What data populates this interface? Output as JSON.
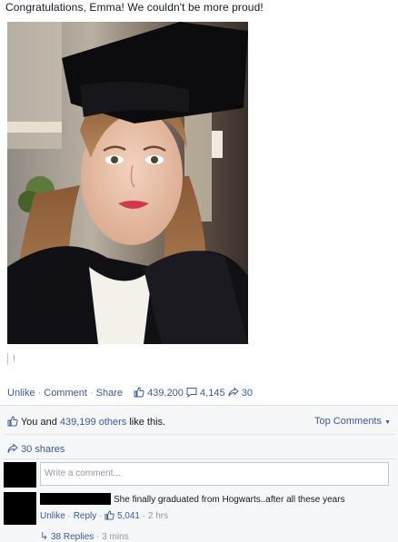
{
  "post": {
    "caption": "Congratulations, Emma! We couldn't be more proud!",
    "attachment_mark": "!"
  },
  "actions": {
    "unlike": "Unlike",
    "comment": "Comment",
    "share": "Share",
    "like_count": "439,200",
    "comment_count": "4,145",
    "share_count": "30",
    "sep": "·"
  },
  "summary": {
    "likes_prefix": "You and ",
    "likes_others": "439,199 others",
    "likes_suffix": " like this.",
    "top_comments": "Top Comments",
    "shares": "30 shares"
  },
  "comment_box": {
    "placeholder": "Write a comment..."
  },
  "comment": {
    "text": "She finally graduated from Hogwarts..after all these years",
    "unlike": "Unlike",
    "reply": "Reply",
    "like_count": "5,041",
    "time": "2 hrs",
    "replies": "38 Replies",
    "replies_time": "3 mins"
  },
  "colors": {
    "link": "#3b5998",
    "panel": "#f6f7f8",
    "muted": "#9197a3"
  },
  "icons": {
    "like": "thumbs-up-icon",
    "comment": "speech-bubble-icon",
    "share": "share-arrow-icon",
    "reply": "reply-arrow-icon"
  }
}
